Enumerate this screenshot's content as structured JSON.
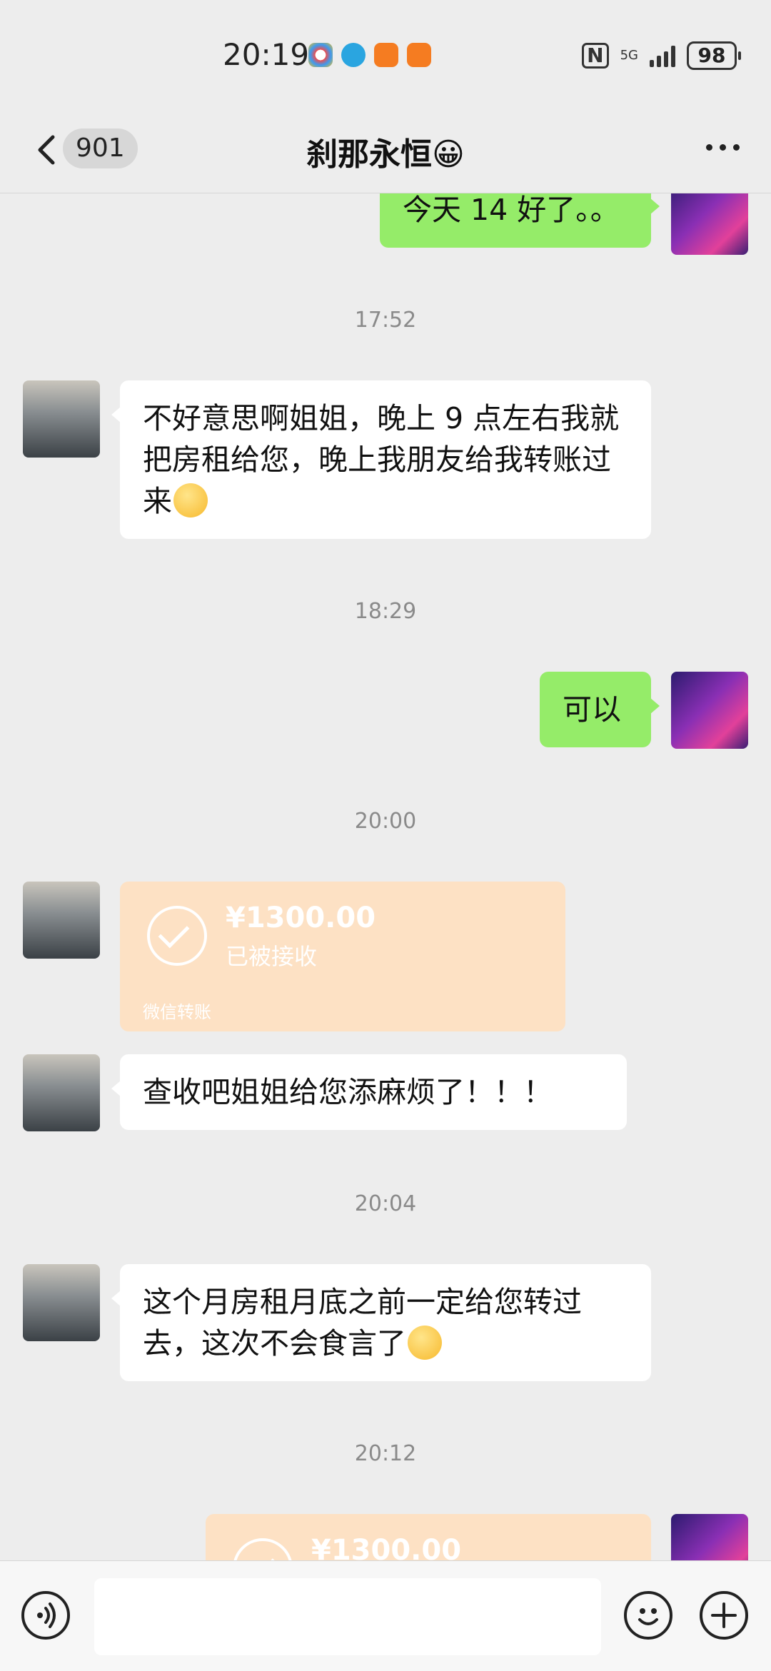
{
  "status_bar": {
    "time": "20:19",
    "network": "5G",
    "battery": "98"
  },
  "header": {
    "back_count": "901",
    "title": "刹那永恒😀"
  },
  "messages": [
    {
      "side": "right",
      "text": "今天 14 好了。。"
    },
    {
      "time": "17:52"
    },
    {
      "side": "left",
      "text": "不好意思啊姐姐，晚上 9 点左右我就把房租给您，晚上我朋友给我转账过来",
      "emoji": "pleading-face"
    },
    {
      "time": "18:29"
    },
    {
      "side": "right",
      "text": "可以"
    },
    {
      "time": "20:00"
    },
    {
      "side": "left",
      "transfer": {
        "amount": "¥1300.00",
        "status": "已被接收",
        "label": "微信转账"
      }
    },
    {
      "side": "left",
      "text": "查收吧姐姐给您添麻烦了！！！"
    },
    {
      "time": "20:04"
    },
    {
      "side": "left",
      "text": "这个月房租月底之前一定给您转过去，这次不会食言了",
      "emoji": "crying-face"
    },
    {
      "time": "20:12"
    },
    {
      "side": "right",
      "transfer": {
        "amount": "¥1300.00"
      }
    }
  ],
  "input_bar": {
    "icons": [
      "voice-icon",
      "emoji-icon",
      "plus-icon"
    ]
  },
  "colors": {
    "background": "#ededed",
    "bubble_self": "#95ec69",
    "bubble_other": "#ffffff",
    "transfer_received": "#fde1c4"
  }
}
